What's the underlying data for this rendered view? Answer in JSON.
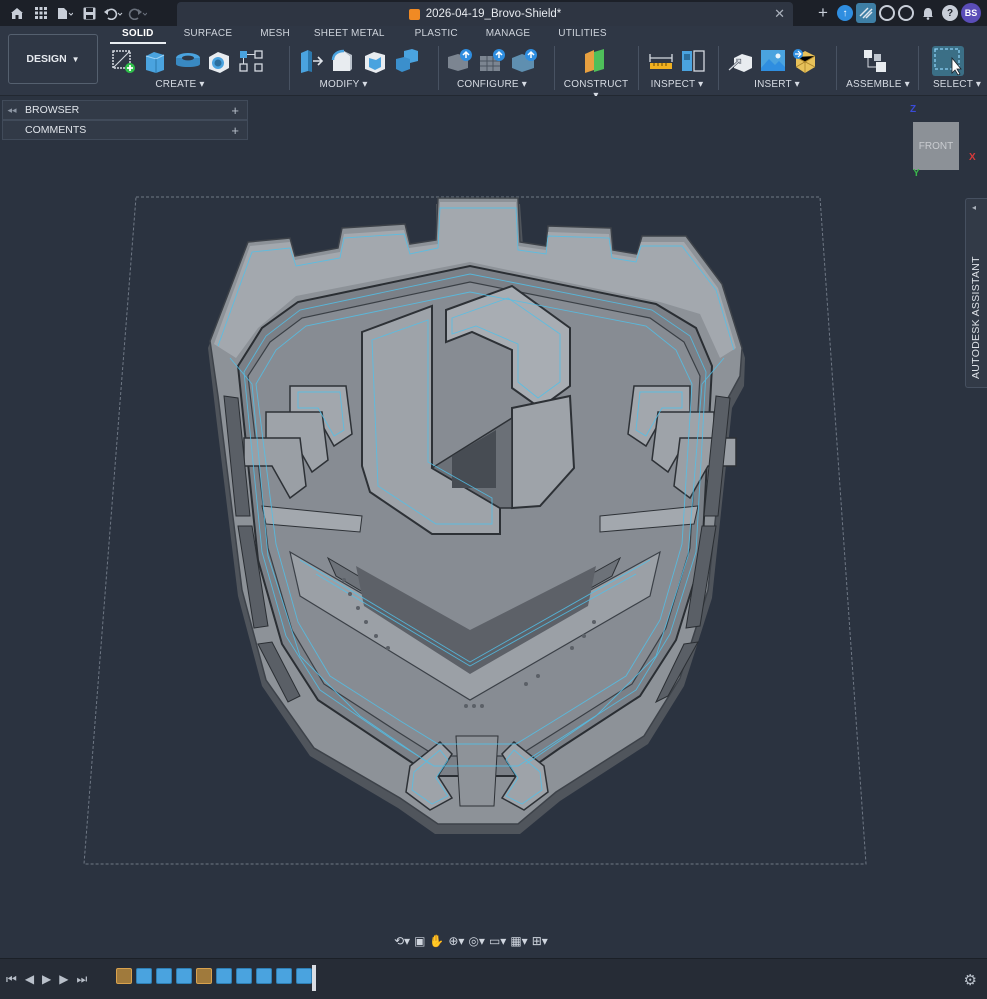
{
  "titlebar": {
    "document_title": "2026-04-19_Brovo-Shield*",
    "avatar_initials": "BS",
    "icons": [
      "home-icon",
      "grid-icon",
      "file-icon",
      "save-icon",
      "undo-icon",
      "redo-icon",
      "close-icon",
      "new-tab-icon",
      "update-icon",
      "extensions-icon",
      "online-icon",
      "clock-icon",
      "bell-icon",
      "help-icon"
    ]
  },
  "ribbon": {
    "workspace": "DESIGN",
    "tabs": [
      "SOLID",
      "SURFACE",
      "MESH",
      "SHEET METAL",
      "PLASTIC",
      "MANAGE",
      "UTILITIES"
    ],
    "active_tab": "SOLID",
    "groups": {
      "create": "CREATE",
      "modify": "MODIFY",
      "configure": "CONFIGURE",
      "construct": "CONSTRUCT",
      "inspect": "INSPECT",
      "insert": "INSERT",
      "assemble": "ASSEMBLE",
      "select": "SELECT"
    },
    "accent_color": "#4aa3df"
  },
  "panels": {
    "browser": "BROWSER",
    "comments": "COMMENTS"
  },
  "viewcube": {
    "face": "FRONT",
    "z": "Z",
    "x": "X",
    "y": "Y"
  },
  "assistant": {
    "label": "AUTODESK ASSISTANT"
  },
  "timeline": {
    "features": [
      "sketch",
      "body",
      "body",
      "body",
      "sketch",
      "body",
      "body",
      "body",
      "body",
      "body"
    ]
  }
}
